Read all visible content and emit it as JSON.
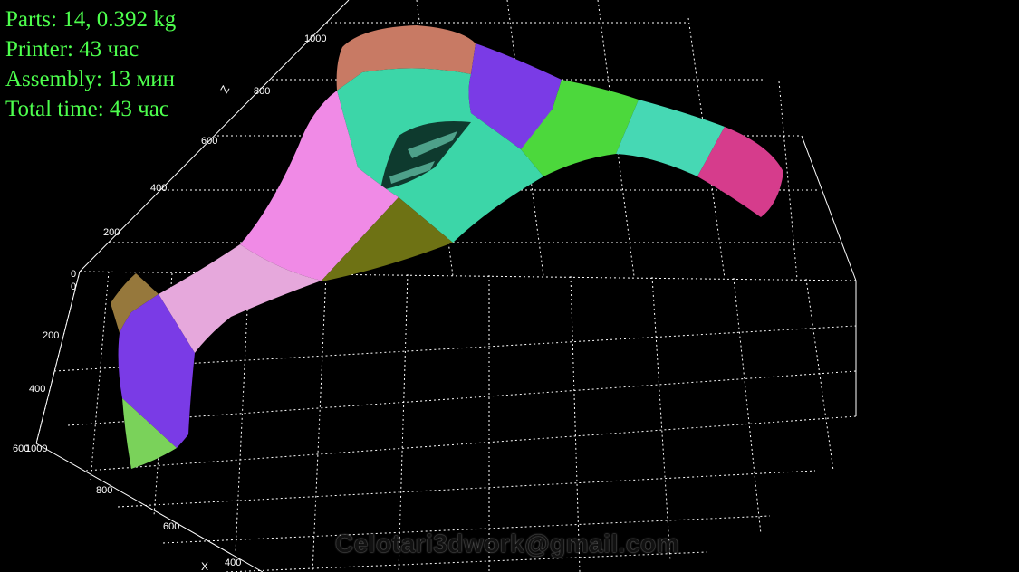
{
  "stats": {
    "parts": "Parts: 14, 0.392 kg",
    "printer": "Printer: 43 час",
    "assembly": "Assembly: 13 мин",
    "total_time": "Total time: 43 час"
  },
  "axes": {
    "z_label": "Z",
    "x_label": "X",
    "z_ticks": [
      "0",
      "200",
      "400",
      "600",
      "800",
      "1000"
    ],
    "y_ticks": [
      "0",
      "200",
      "400",
      "600"
    ],
    "x_ticks": [
      "1000",
      "800",
      "600",
      "400"
    ]
  },
  "watermark": "Celotari3dwork@gmail.com",
  "colors": {
    "stats_text": "#4dff4d",
    "grid": "#ffffff",
    "background": "#000000",
    "part_salmon": "#c87a64",
    "part_teal": "#3cd6a8",
    "part_purple": "#7a3be6",
    "part_green": "#4cd83c",
    "part_aqua": "#46d8b4",
    "part_magenta": "#d63c8c",
    "part_pink": "#f08ae6",
    "part_olive": "#6e7214",
    "part_lightpink": "#e6a8dc",
    "part_tan": "#96783c",
    "part_lightgreen": "#7ad25a"
  }
}
